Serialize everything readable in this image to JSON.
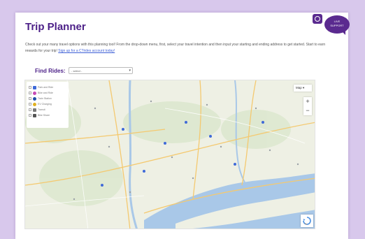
{
  "page": {
    "title": "Trip Planner",
    "intro_text": "Check out your many travel options with this planning tool! From the drop-down menu, first, select your travel intention and then input your starting and ending address to get started. Start to earn rewards for your trip! ",
    "intro_link": "Sign up for a CTrides account today!"
  },
  "find_rides": {
    "label": "Find Rides:",
    "selected": "- select -"
  },
  "map": {
    "type_label": "Map",
    "zoom_in": "+",
    "zoom_out": "−",
    "legend": [
      {
        "label": "Park and Ride",
        "color": "#3f6ad8"
      },
      {
        "label": "Bike and Ride",
        "color": "#c64ab5"
      },
      {
        "label": "Train Station",
        "color": "#1f4fa8"
      },
      {
        "label": "EV Charging",
        "color": "#e0b020"
      },
      {
        "label": "Transit",
        "color": "#7a7a7a"
      },
      {
        "label": "Bike Share",
        "color": "#555555"
      }
    ]
  },
  "live_support": {
    "line1": "LIVE",
    "line2": "SUPPORT"
  },
  "colors": {
    "brand_purple": "#4b1f87",
    "background": "#d8c8ec",
    "water": "#a9c8e8",
    "land": "#eef0e4"
  }
}
